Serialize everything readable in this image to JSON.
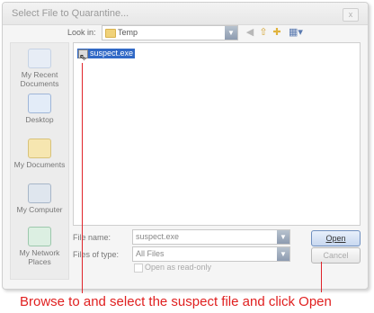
{
  "window": {
    "title": "Select File to Quarantine...",
    "close_glyph": "x"
  },
  "lookin": {
    "label": "Look in:",
    "value": "Temp"
  },
  "toolbar_icons": [
    "back-icon",
    "up-folder-icon",
    "new-folder-icon",
    "views-menu-icon"
  ],
  "places": [
    {
      "key": "recent",
      "label": "My Recent Documents",
      "icon": "recent-documents-icon"
    },
    {
      "key": "desktop",
      "label": "Desktop",
      "icon": "desktop-icon"
    },
    {
      "key": "mydocs",
      "label": "My Documents",
      "icon": "my-documents-icon"
    },
    {
      "key": "computer",
      "label": "My Computer",
      "icon": "my-computer-icon"
    },
    {
      "key": "network",
      "label": "My Network Places",
      "icon": "network-places-icon"
    }
  ],
  "files": [
    {
      "name": "suspect.exe",
      "selected": true
    }
  ],
  "filename": {
    "label": "File name:",
    "value": "suspect.exe"
  },
  "filetype": {
    "label": "Files of type:",
    "value": "All Files"
  },
  "readonly": {
    "label": "Open as read-only",
    "checked": false
  },
  "buttons": {
    "open": "Open",
    "cancel": "Cancel"
  },
  "caption": "Browse to and select the suspect file and click Open",
  "colors": {
    "selection": "#3169c6",
    "annotation": "#e0242a"
  }
}
